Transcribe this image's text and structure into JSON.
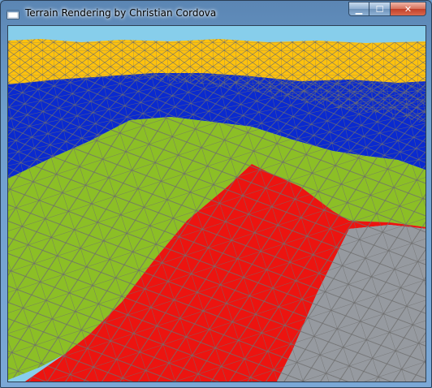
{
  "window": {
    "title": "Terrain Rendering by Christian Cordova",
    "icon": "app-window-icon",
    "controls": {
      "minimize_icon": "minimize-icon",
      "maximize_icon": "maximize-icon",
      "close_icon": "close-icon",
      "minimize_glyph": "▁",
      "maximize_glyph": "☐",
      "close_glyph": "✕"
    }
  },
  "viewport": {
    "sky_color": "#87CEEB",
    "band_colors": {
      "far": "#FFC20E",
      "water": "#0A2ACF",
      "grass": "#8CBF26",
      "soil": "#EC1410",
      "rock": "#969AA0"
    },
    "wire_color": "#6E6E6E"
  }
}
